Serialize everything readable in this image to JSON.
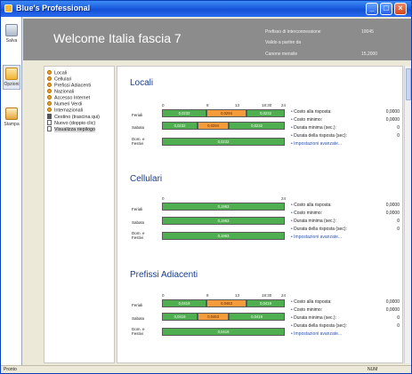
{
  "window": {
    "title": "Blue's Professional"
  },
  "toolbar": {
    "save": "Salva",
    "options": "Opzioni",
    "print": "Stampa"
  },
  "header": {
    "title": "Welcome Italia fascia 7",
    "k1": "Prefisso di interconnessione",
    "v1": "10045",
    "k2": "Valido a partire da",
    "k3": "Canone mensile",
    "v3": "15,2000"
  },
  "nav": [
    {
      "label": "Locali",
      "icon": "dot-icon"
    },
    {
      "label": "Cellulari",
      "icon": "dot-icon"
    },
    {
      "label": "Prefissi Adiacenti",
      "icon": "dot-icon"
    },
    {
      "label": "Nazionali",
      "icon": "dot-icon"
    },
    {
      "label": "Accesso Internet",
      "icon": "dot-icon"
    },
    {
      "label": "Numeri Verdi",
      "icon": "dot-icon"
    },
    {
      "label": "Internazionali",
      "icon": "dot-icon"
    },
    {
      "label": "Cestino (trascina qui)",
      "icon": "trash-icon"
    },
    {
      "label": "Nuovo (doppio clic)",
      "icon": "new-doc-icon"
    },
    {
      "label": "Visualizza riepilogo",
      "icon": "doc-icon"
    }
  ],
  "row_labels": {
    "feriali": "Feriali",
    "sabato": "Sabato",
    "festivi_1": "Dom. e",
    "festivi_2": "Festivi"
  },
  "info_labels": {
    "costo_risposta": "Costo alla risposta:",
    "costo_minimo": "Costo minimo:",
    "durata_minima": "Durata minima (sec.):",
    "durata_risposta": "Durata della risposta (sec):",
    "impostazioni": "Impostazioni avanzate..."
  },
  "sections": [
    {
      "title": "Locali",
      "ticks": [
        "0",
        "8",
        "13",
        "18:30",
        "24"
      ],
      "feriali": [
        "0,0232",
        "0,0294",
        "0,0232"
      ],
      "sabato": [
        "0,0232",
        "0,0294",
        "0,0232"
      ],
      "festivi": "0,0232",
      "costo_risposta": "0,0000",
      "costo_minimo": "0,0000",
      "durata_minima": "0",
      "durata_risposta": "0"
    },
    {
      "title": "Cellulari",
      "ticks": [
        "0",
        "24"
      ],
      "feriali": "0,1963",
      "sabato": "0,1963",
      "festivi": "0,1963",
      "costo_risposta": "0,0000",
      "costo_minimo": "0,0000",
      "durata_minima": "0",
      "durata_risposta": "0"
    },
    {
      "title": "Prefissi Adiacenti",
      "ticks": [
        "0",
        "8",
        "13",
        "18:30",
        "24"
      ],
      "feriali": [
        "0,0419",
        "0,0463",
        "0,0419"
      ],
      "sabato": [
        "0,0419",
        "0,0463",
        "0,0419"
      ],
      "festivi": "0,0419",
      "costo_risposta": "0,0000",
      "costo_minimo": "0,0000",
      "durata_minima": "0",
      "durata_risposta": "0"
    }
  ],
  "statusbar": {
    "left": "Pronto",
    "right": "NUM"
  },
  "colors": {
    "green": "#4fae4f",
    "orange": "#f59b3a",
    "header": "#8c8c8c"
  }
}
